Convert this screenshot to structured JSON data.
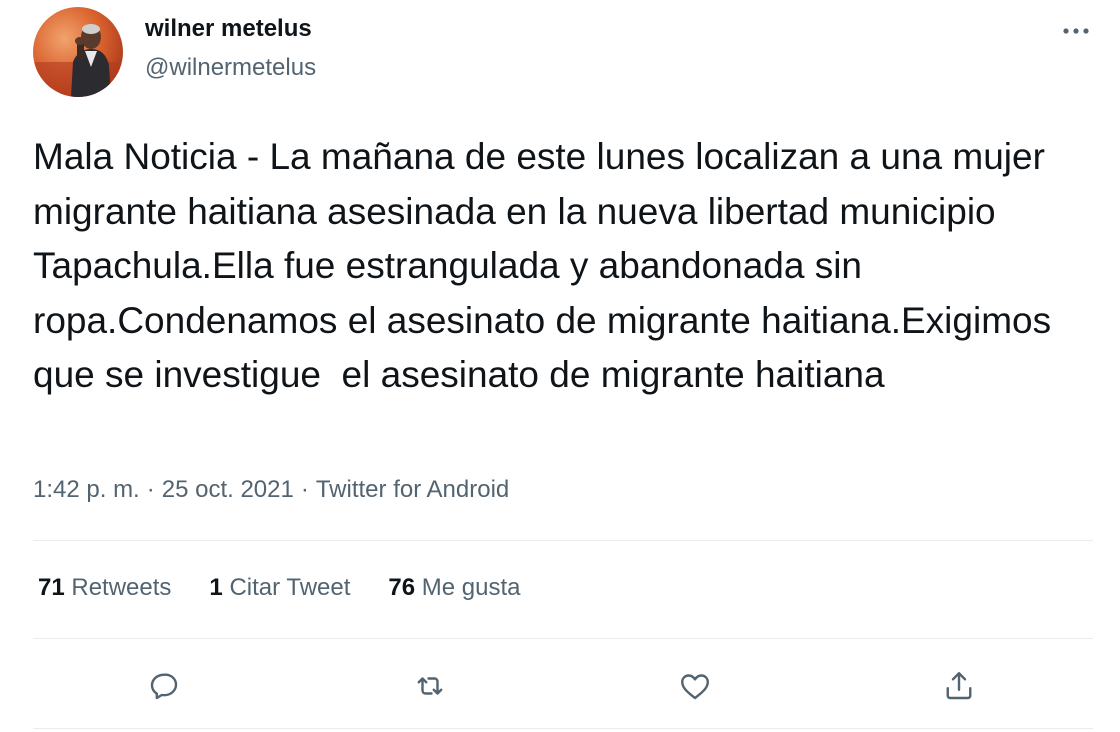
{
  "user": {
    "display_name": "wilner metelus",
    "handle": "@wilnermetelus"
  },
  "tweet": {
    "text": "Mala Noticia - La mañana de este lunes localizan a una mujer migrante haitiana asesinada en la nueva libertad municipio Tapachula.Ella fue estrangulada y abandonada sin ropa.Condenamos el asesinato de migrante haitiana.Exigimos que se investigue  el asesinato de migrante haitiana",
    "time": "1:42 p. m.",
    "separator": "·",
    "date": "25 oct. 2021",
    "source": "Twitter for Android"
  },
  "stats": {
    "retweets_count": "71",
    "retweets_label": "Retweets",
    "quotes_count": "1",
    "quotes_label": "Citar Tweet",
    "likes_count": "76",
    "likes_label": "Me gusta"
  },
  "icons": {
    "more": "more-horizontal-icon",
    "reply": "reply-icon",
    "retweet": "retweet-icon",
    "like": "heart-icon",
    "share": "share-icon"
  },
  "colors": {
    "text_primary": "#0f1419",
    "text_secondary": "#536471",
    "divider": "#e6ecf0",
    "background": "#ffffff"
  }
}
